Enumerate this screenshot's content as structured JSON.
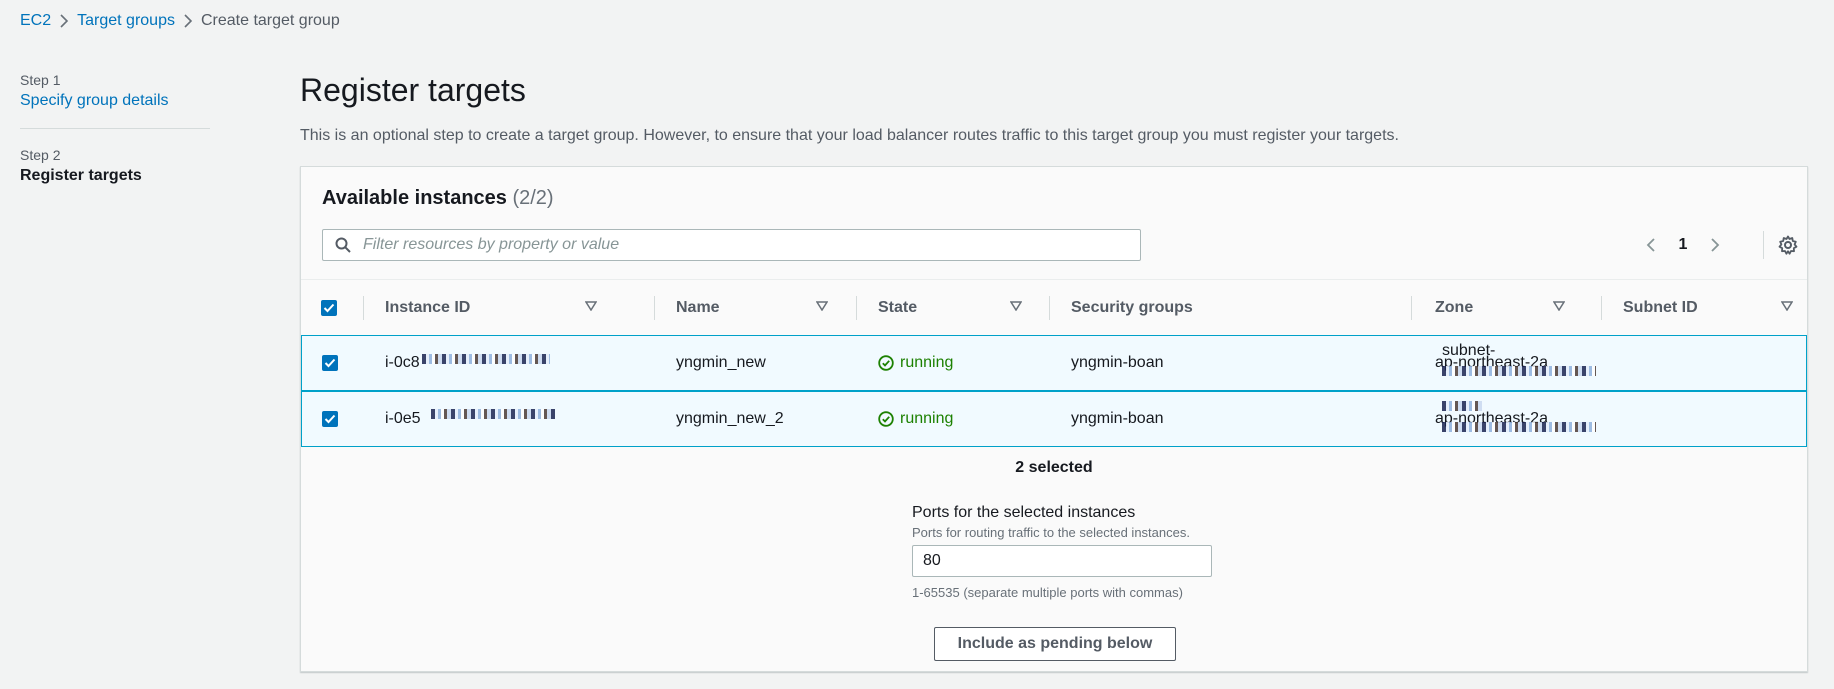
{
  "breadcrumb": {
    "items": [
      "EC2",
      "Target groups"
    ],
    "current": "Create target group"
  },
  "steps": [
    {
      "num": "Step 1",
      "label": "Specify group details"
    },
    {
      "num": "Step 2",
      "label": "Register targets"
    }
  ],
  "page": {
    "title": "Register targets",
    "description": "This is an optional step to create a target group. However, to ensure that your load balancer routes traffic to this target group you must register your targets."
  },
  "available": {
    "title": "Available instances",
    "count": "(2/2)",
    "filter_placeholder": "Filter resources by property or value",
    "page_number": "1"
  },
  "table": {
    "columns": [
      "Instance ID",
      "Name",
      "State",
      "Security groups",
      "Zone",
      "Subnet ID"
    ],
    "rows": [
      {
        "instance_id": "i-0c8",
        "name": "yngmin_new",
        "state": "running",
        "security_groups": "yngmin-boan",
        "zone": "ap-northeast-2a",
        "subnet_id": "subnet-"
      },
      {
        "instance_id": "i-0e5",
        "name": "yngmin_new_2",
        "state": "running",
        "security_groups": "yngmin-boan",
        "zone": "ap-northeast-2a",
        "subnet_id": ""
      }
    ]
  },
  "selection": {
    "selected_text": "2 selected",
    "ports_label": "Ports for the selected instances",
    "ports_desc": "Ports for routing traffic to the selected instances.",
    "ports_value": "80",
    "ports_hint": "1-65535 (separate multiple ports with commas)",
    "include_button": "Include as pending below"
  },
  "colors": {
    "link": "#0073bb",
    "running": "#1d8102",
    "selected_row_bg": "#f1faff",
    "selected_row_border": "#00a1c9"
  }
}
